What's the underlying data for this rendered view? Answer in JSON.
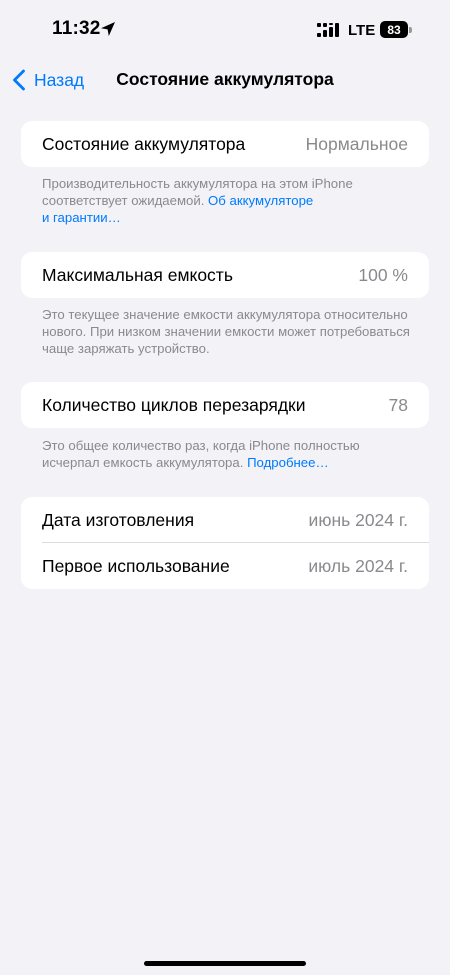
{
  "status_bar": {
    "time": "11:32",
    "network_type": "LTE",
    "battery_level": "83"
  },
  "nav": {
    "back_label": "Назад",
    "title": "Состояние аккумулятора"
  },
  "battery_health": {
    "label": "Состояние аккумулятора",
    "value": "Нормальное",
    "footnote_text": "Производительность аккумулятора на этом iPhone соответствует ожидаемой.",
    "footnote_link_line1": "Об аккумуляторе",
    "footnote_link_line2": "и гарантии…"
  },
  "max_capacity": {
    "label": "Максимальная емкость",
    "value": "100 %",
    "footnote_text": "Это текущее значение емкости аккумулятора относительно нового. При низком значении емкости может потребоваться чаще заряжать устройство."
  },
  "cycle_count": {
    "label": "Количество циклов перезарядки",
    "value": "78",
    "footnote_text": "Это общее количество раз, когда iPhone полностью исчерпал емкость аккумулятора.",
    "footnote_link": "Подробнее…"
  },
  "dates": {
    "manufacture_label": "Дата изготовления",
    "manufacture_value": "июнь 2024 г.",
    "first_use_label": "Первое использование",
    "first_use_value": "июль 2024 г."
  },
  "colors": {
    "accent": "#007aff",
    "background": "#f2f2f7",
    "secondary_text": "#8a8a8e"
  }
}
